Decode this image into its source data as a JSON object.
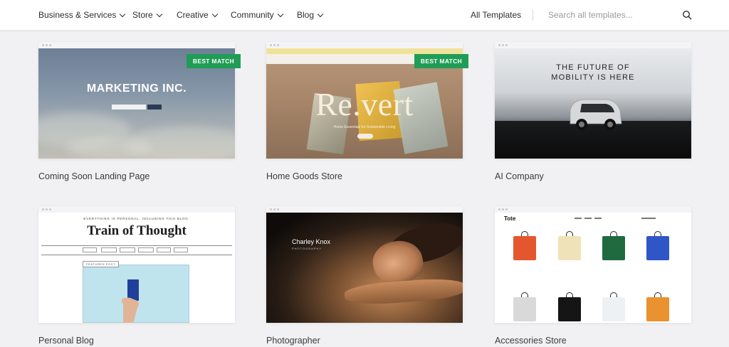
{
  "nav": {
    "items": [
      {
        "label": "Business & Services"
      },
      {
        "label": "Store"
      },
      {
        "label": "Creative"
      },
      {
        "label": "Community"
      },
      {
        "label": "Blog"
      }
    ],
    "all_templates": "All Templates",
    "search_placeholder": "Search all templates..."
  },
  "badge_label": "BEST MATCH",
  "templates": [
    {
      "title": "Coming Soon Landing Page",
      "preview_heading": "MARKETING INC.",
      "best_match": true
    },
    {
      "title": "Home Goods Store",
      "preview_heading": "Re.vert",
      "preview_tagline": "Home Essentials for Sustainable Living",
      "best_match": true
    },
    {
      "title": "AI Company",
      "preview_heading_line1": "THE FUTURE OF",
      "preview_heading_line2": "MOBILITY IS HERE",
      "best_match": false
    },
    {
      "title": "Personal Blog",
      "preview_kicker": "EVERYTHING IS PERSONAL. INCLUDING THIS BLOG.",
      "preview_heading": "Train of Thought",
      "preview_tag": "FEATURED POST",
      "best_match": false
    },
    {
      "title": "Photographer",
      "preview_name": "Charley Knox",
      "preview_sub": "PHOTOGRAPHY",
      "best_match": false
    },
    {
      "title": "Accessories Store",
      "preview_brand": "Tote",
      "best_match": false
    }
  ],
  "colors": {
    "badge": "#1f9d55",
    "background": "#f1f1f3"
  },
  "icons": {
    "search": "search-icon",
    "chevron": "chevron-down-icon"
  }
}
